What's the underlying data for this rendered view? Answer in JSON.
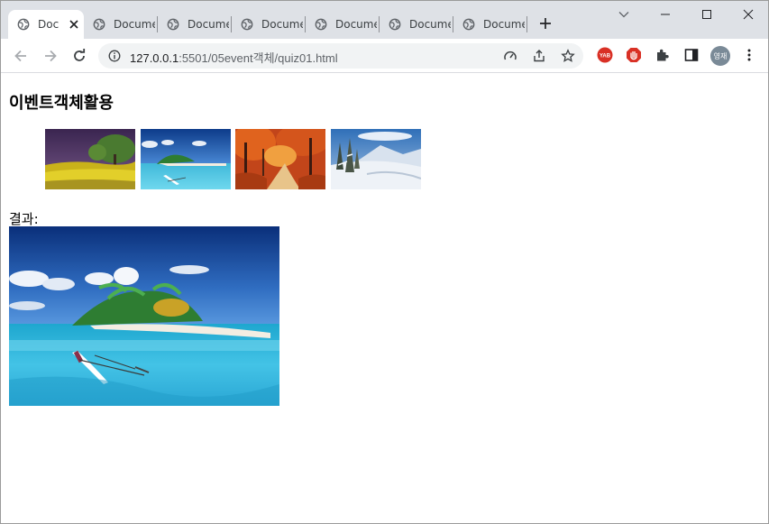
{
  "browser": {
    "tabs": [
      {
        "title": "Document",
        "active": true
      },
      {
        "title": "Document",
        "active": false
      },
      {
        "title": "Document",
        "active": false
      },
      {
        "title": "Document",
        "active": false
      },
      {
        "title": "Document",
        "active": false
      },
      {
        "title": "Document",
        "active": false
      },
      {
        "title": "Document",
        "active": false
      }
    ],
    "url_host": "127.0.0.1",
    "url_rest": ":5501/05event객체/quiz01.html",
    "extensions": [
      "yab-extension-icon",
      "adblock-extension-icon",
      "puzzle-extensions-icon",
      "side-panel-icon"
    ],
    "profile_initials": "영재"
  },
  "page": {
    "heading": "이벤트객체활용",
    "thumbnails": [
      {
        "name": "field-trees",
        "alt": "yellow field with trees"
      },
      {
        "name": "tropical-island",
        "alt": "tropical island with boat"
      },
      {
        "name": "autumn-forest",
        "alt": "autumn forest path"
      },
      {
        "name": "winter-snow",
        "alt": "snowy winter mountains"
      }
    ],
    "result_label": "결과:",
    "result_image": "tropical-island"
  },
  "colors": {
    "tabstrip": "#dee1e6",
    "omnibox": "#f1f3f4",
    "accent_red": "#d93025"
  }
}
